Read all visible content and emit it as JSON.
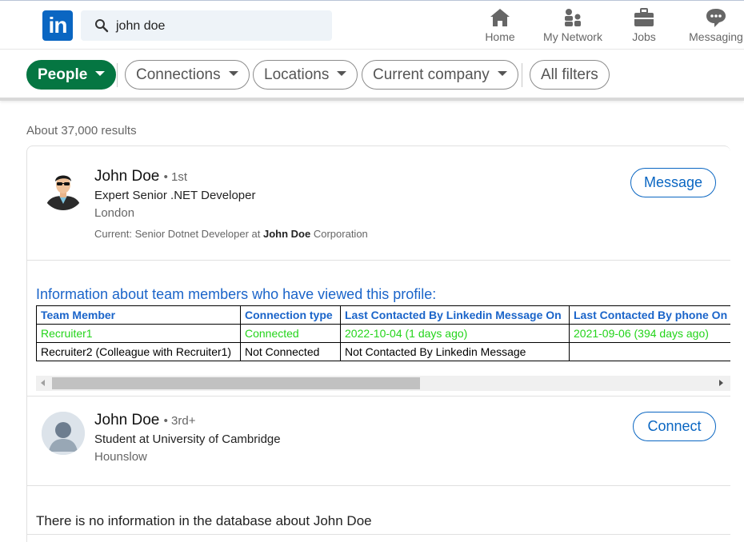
{
  "search": {
    "value": "john doe"
  },
  "logo": {
    "text": "in"
  },
  "nav": [
    {
      "label": "Home",
      "icon": "home-icon"
    },
    {
      "label": "My Network",
      "icon": "network-icon"
    },
    {
      "label": "Jobs",
      "icon": "briefcase-icon"
    },
    {
      "label": "Messaging",
      "icon": "messaging-icon"
    }
  ],
  "filters": {
    "people": "People",
    "connections": "Connections",
    "locations": "Locations",
    "current_company": "Current company",
    "all_filters": "All filters"
  },
  "results_count": "About 37,000 results",
  "results": [
    {
      "name": "John Doe",
      "degree": "• 1st",
      "headline": "Expert Senior .NET Developer",
      "location": "London",
      "current_prefix": "Current: Senior Dotnet Developer at ",
      "current_bold": "John Doe",
      "current_suffix": " Corporation",
      "action": "Message"
    },
    {
      "name": "John Doe",
      "degree": "• 3rd+",
      "headline": "Student at University of Cambridge",
      "location": "Hounslow",
      "action": "Connect"
    }
  ],
  "team_info": {
    "heading": "Information about team members who have viewed this profile:",
    "columns": [
      "Team Member",
      "Connection type",
      "Last Contacted By Linkedin Message On",
      "Last Contacted By phone On"
    ],
    "rows": [
      [
        "Recruiter1",
        "Connected",
        "2022-10-04 (1 days ago)",
        "2021-09-06 (394 days ago)"
      ],
      [
        "Recruiter2 (Colleague with Recruiter1)",
        "Not Connected",
        "Not Contacted By Linkedin Message",
        ""
      ]
    ]
  },
  "no_info": "There is no information in the database about John Doe",
  "colors": {
    "brand": "#0a66c2",
    "people_pill": "#057642",
    "table_heading": "#1a64c9",
    "connected_row": "#23d41a"
  }
}
